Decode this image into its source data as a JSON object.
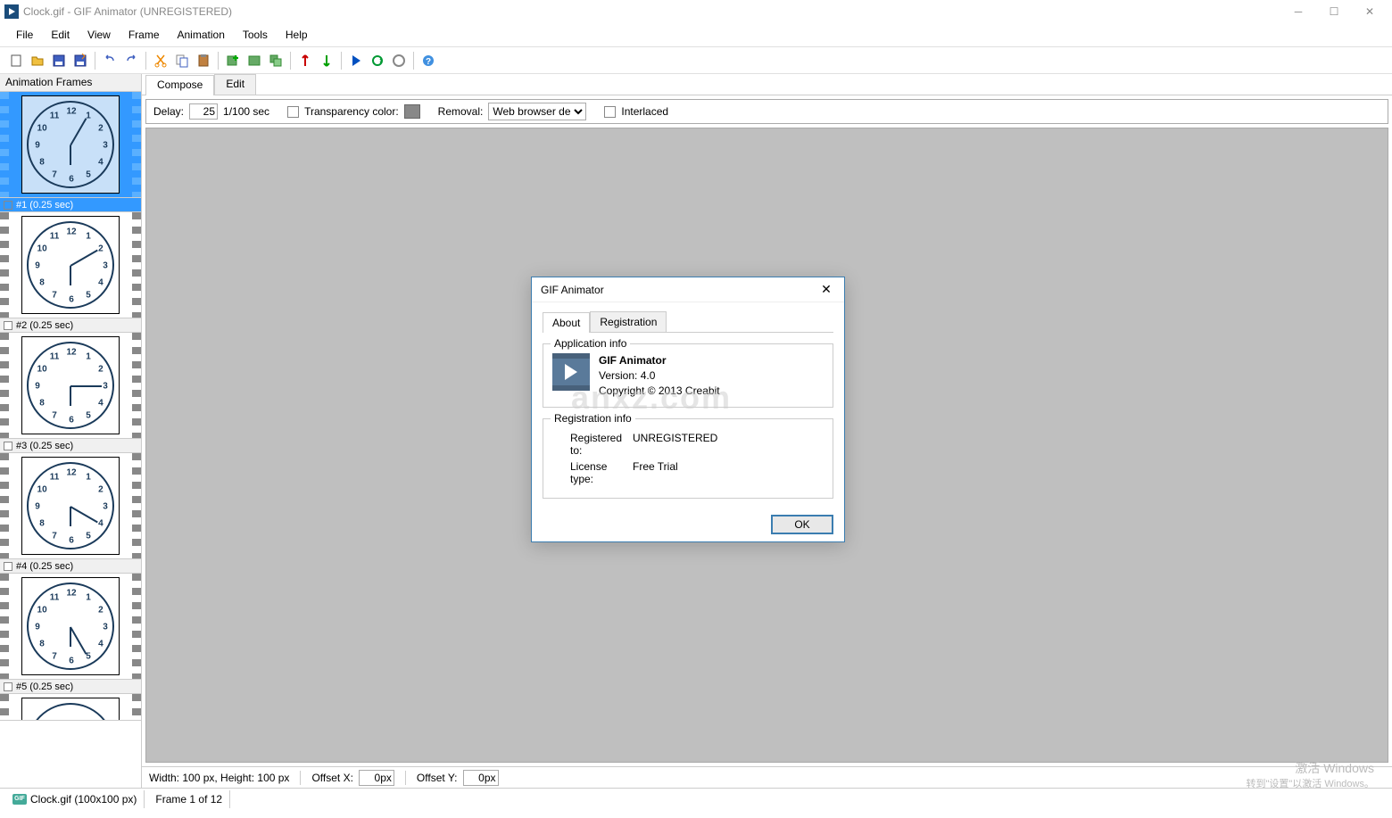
{
  "titlebar": {
    "title": "Clock.gif - GIF Animator (UNREGISTERED)"
  },
  "menubar": [
    "File",
    "Edit",
    "View",
    "Frame",
    "Animation",
    "Tools",
    "Help"
  ],
  "sidepanel": {
    "header": "Animation Frames",
    "frames": [
      {
        "label": "#1 (0.25 sec)",
        "selected": true,
        "minute": 5
      },
      {
        "label": "#2 (0.25 sec)",
        "selected": false,
        "minute": 10
      },
      {
        "label": "#3 (0.25 sec)",
        "selected": false,
        "minute": 15
      },
      {
        "label": "#4 (0.25 sec)",
        "selected": false,
        "minute": 20
      },
      {
        "label": "#5 (0.25 sec)",
        "selected": false,
        "minute": 25
      }
    ]
  },
  "tabs": {
    "compose": "Compose",
    "edit": "Edit"
  },
  "propbar": {
    "delayLabel": "Delay:",
    "delayValue": "25",
    "delayUnit": "1/100 sec",
    "transparencyLabel": "Transparency color:",
    "removalLabel": "Removal:",
    "removalValue": "Web browser de",
    "interlacedLabel": "Interlaced"
  },
  "editorStatus": {
    "dimensions": "Width: 100 px, Height: 100 px",
    "offsetXLabel": "Offset X:",
    "offsetXValue": "0px",
    "offsetYLabel": "Offset Y:",
    "offsetYValue": "0px"
  },
  "statusbar": {
    "filename": "Clock.gif (100x100 px)",
    "frame": "Frame 1 of 12"
  },
  "dialog": {
    "title": "GIF Animator",
    "tabs": {
      "about": "About",
      "registration": "Registration"
    },
    "appInfoLegend": "Application info",
    "appName": "GIF Animator",
    "version": "Version: 4.0",
    "copyright": "Copyright © 2013 Creabit",
    "regInfoLegend": "Registration info",
    "registeredToLabel": "Registered to:",
    "registeredToValue": "UNREGISTERED",
    "licenseTypeLabel": "License type:",
    "licenseTypeValue": "Free Trial",
    "okButton": "OK"
  },
  "watermark": {
    "main": "anxz.com",
    "line1": "激活 Windows",
    "line2": "转到\"设置\"以激活 Windows。"
  }
}
